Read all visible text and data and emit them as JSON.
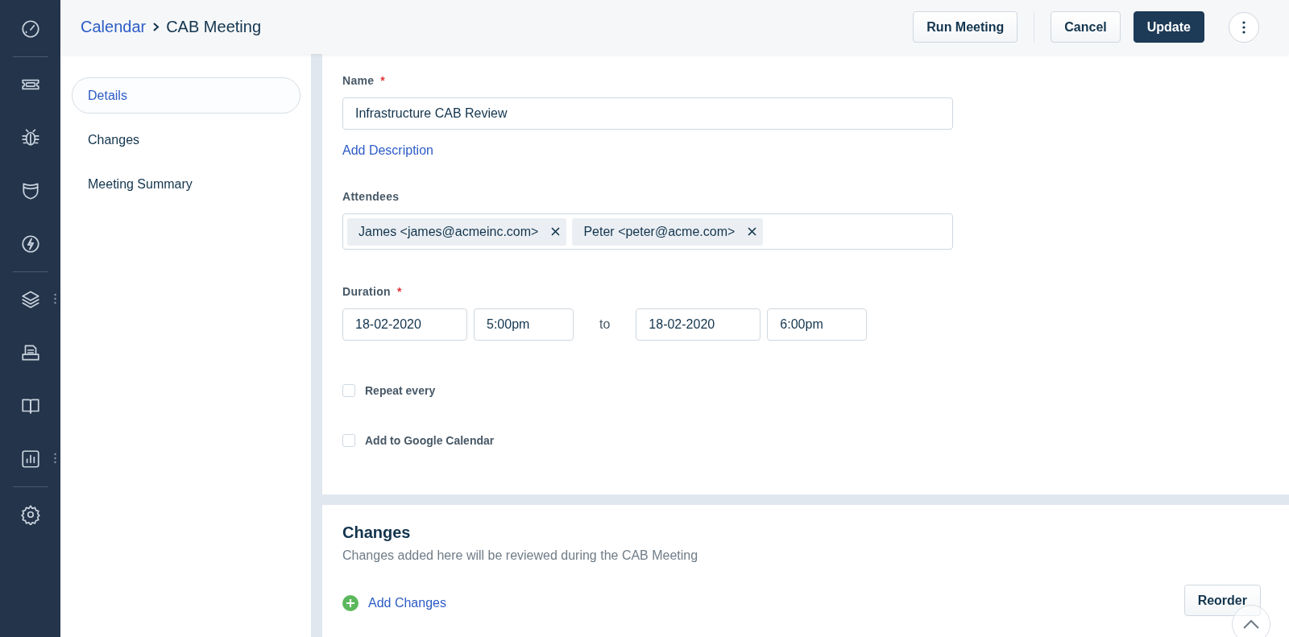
{
  "breadcrumb": {
    "parent": "Calendar",
    "title": "CAB Meeting"
  },
  "actions": [
    {
      "label": "Run Meeting",
      "kind": "secondary"
    },
    {
      "label": "Cancel",
      "kind": "secondary"
    },
    {
      "label": "Update",
      "kind": "primary"
    }
  ],
  "section_nav": [
    {
      "label": "Details",
      "selected": true
    },
    {
      "label": "Changes",
      "selected": false
    },
    {
      "label": "Meeting Summary",
      "selected": false
    }
  ],
  "form": {
    "name": {
      "label": "Name",
      "required": true,
      "required_mark": "*",
      "value": "Infrastructure CAB Review"
    },
    "add_description": "Add Description",
    "attendees": {
      "label": "Attendees",
      "chips": [
        "James <james@acmeinc.com>",
        "Peter <peter@acme.com>"
      ]
    },
    "duration": {
      "label": "Duration",
      "required": true,
      "required_mark": "*",
      "start_date": "18-02-2020",
      "start_time": "5:00pm",
      "separator": "to",
      "end_date": "18-02-2020",
      "end_time": "6:00pm"
    },
    "options": [
      {
        "label": "Repeat every",
        "checked": false
      },
      {
        "label": "Add to Google Calendar",
        "checked": false
      }
    ]
  },
  "changes_section": {
    "title": "Changes",
    "subtitle": "Changes added here will be reviewed during the CAB Meeting",
    "add_link": "Add Changes",
    "reorder_button": "Reorder"
  }
}
